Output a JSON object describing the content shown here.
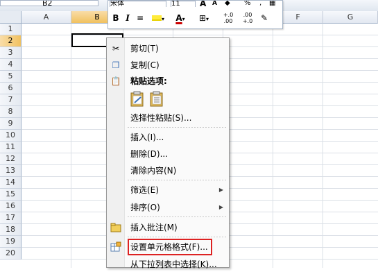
{
  "name_box": {
    "value": "B2"
  },
  "mini_toolbar": {
    "font_name": "宋体",
    "font_size": "11",
    "bold_label": "B",
    "italic_label": "I",
    "font_color_label": "A",
    "percent_label": "%",
    "inc_decimal_label": "+.0 .00",
    "dec_decimal_label": ".00 +.0",
    "grow_font_label": "A",
    "shrink_font_label": "A"
  },
  "grid": {
    "columns": [
      "A",
      "B",
      "C",
      "D",
      "E",
      "F",
      "G"
    ],
    "rows": [
      "1",
      "2",
      "3",
      "4",
      "5",
      "6",
      "7",
      "8",
      "9",
      "10",
      "11",
      "12",
      "13",
      "14",
      "15",
      "16",
      "17",
      "18",
      "19",
      "20"
    ],
    "selected_column": "B",
    "selected_row": "2"
  },
  "context_menu": {
    "cut": "剪切(T)",
    "copy": "复制(C)",
    "paste_options": "粘贴选项:",
    "paste_special": "选择性粘贴(S)...",
    "insert": "插入(I)...",
    "delete": "删除(D)...",
    "clear_contents": "清除内容(N)",
    "filter": "筛选(E)",
    "sort": "排序(O)",
    "insert_comment": "插入批注(M)",
    "format_cells": "设置单元格格式(F)...",
    "pick_from_list": "从下拉列表中选择(K)..."
  },
  "colors": {
    "highlight": "#dd2222",
    "font_color": "#cc0000"
  }
}
